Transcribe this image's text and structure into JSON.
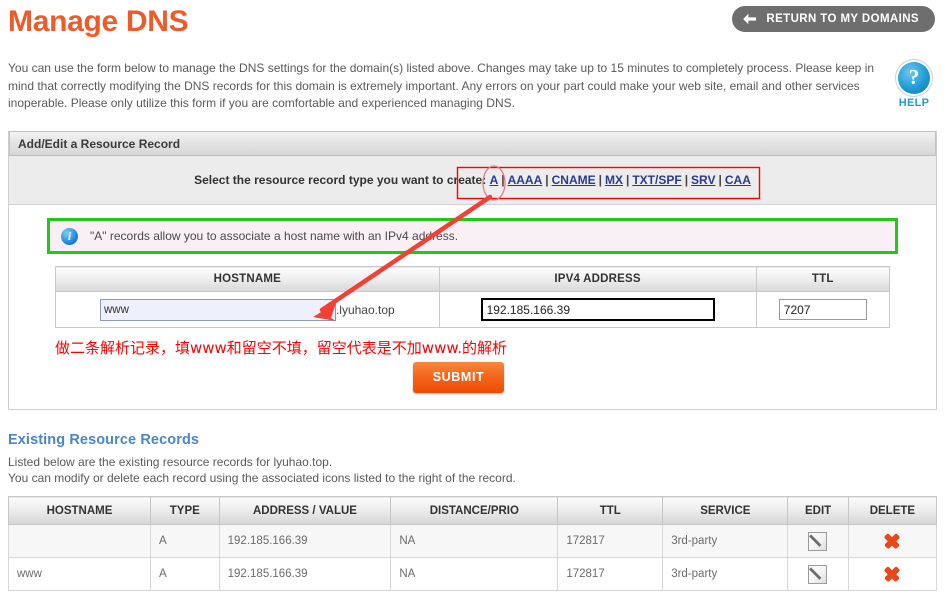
{
  "header": {
    "title": "Manage DNS",
    "return_button": "RETURN TO MY DOMAINS",
    "back_arrow_icon": "arrow-left-icon"
  },
  "intro": {
    "paragraph": "You can use the form below to manage the DNS settings for the domain(s) listed above. Changes may take up to 15 minutes to completely process. Please keep in mind that correctly modifying the DNS records for this domain is extremely important. Any errors on your part could make your web site, email and other services inoperable. Please only utilize this form if you are comfortable and experienced managing DNS."
  },
  "help": {
    "icon": "question-mark-icon",
    "glyph": "?",
    "label": "HELP"
  },
  "panel": {
    "heading": "Add/Edit a Resource Record",
    "selector_prompt": "Select the resource record type you want to create:",
    "record_types": [
      "A",
      "AAAA",
      "CNAME",
      "MX",
      "TXT/SPF",
      "SRV",
      "CAA"
    ],
    "selected_record_type": "A",
    "separator": "|",
    "info": {
      "icon": "info-icon",
      "glyph": "i",
      "text": "\"A\" records allow you to associate a host name with an IPv4 address."
    },
    "form": {
      "columns": [
        "HOSTNAME",
        "IPV4 ADDRESS",
        "TTL"
      ],
      "hostname_value": "www",
      "hostname_placeholder": "",
      "hostname_suffix": ".lyuhao.top",
      "ipv4_value": "192.185.166.39",
      "ipv4_placeholder": "",
      "ttl_value": "7207",
      "ttl_placeholder": ""
    },
    "annotation_note": "做二条解析记录，填www和留空不填，留空代表是不加www.的解析",
    "submit_label": "SUBMIT"
  },
  "existing": {
    "title": "Existing Resource Records",
    "desc_line1": "Listed below are the existing resource records for lyuhao.top.",
    "desc_line2": "You can modify or delete each record using the associated icons listed to the right of the record.",
    "columns": [
      "HOSTNAME",
      "TYPE",
      "ADDRESS / VALUE",
      "DISTANCE/PRIO",
      "TTL",
      "SERVICE",
      "EDIT",
      "DELETE"
    ],
    "rows": [
      {
        "hostname": "",
        "type": "A",
        "address": "192.185.166.39",
        "distance": "NA",
        "ttl": "172817",
        "service": "3rd-party",
        "edit_icon": "pencil-edit-icon",
        "delete_icon": "x-delete-icon"
      },
      {
        "hostname": "www",
        "type": "A",
        "address": "192.185.166.39",
        "distance": "NA",
        "ttl": "172817",
        "service": "3rd-party",
        "edit_icon": "pencil-edit-icon",
        "delete_icon": "x-delete-icon"
      }
    ]
  },
  "colors": {
    "brand_orange": "#ee5b2b",
    "link_blue": "#2b3a8f",
    "heading_blue": "#4a87c8",
    "annotation_red": "#ff0000",
    "annotation_green": "#22c816",
    "help_blue": "#1f9bd4",
    "delete_orange": "#e8491c"
  }
}
